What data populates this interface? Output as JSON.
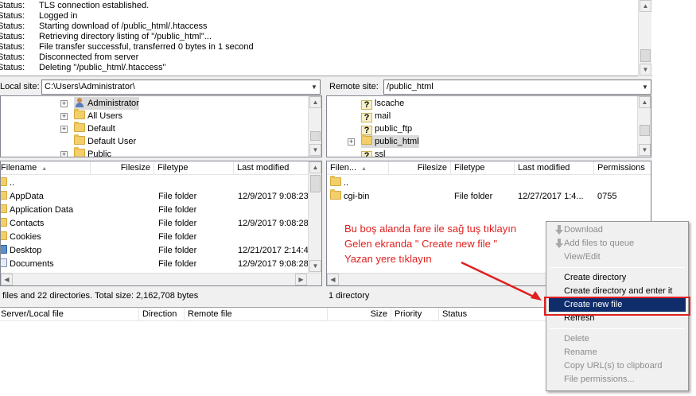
{
  "log": [
    {
      "label": "Status:",
      "text": "TLS connection established."
    },
    {
      "label": "Status:",
      "text": "Logged in"
    },
    {
      "label": "Status:",
      "text": "Starting download of /public_html/.htaccess"
    },
    {
      "label": "Status:",
      "text": "Retrieving directory listing of \"/public_html\"..."
    },
    {
      "label": "Status:",
      "text": "File transfer successful, transferred 0 bytes in 1 second"
    },
    {
      "label": "Status:",
      "text": "Disconnected from server"
    },
    {
      "label": "Status:",
      "text": "Deleting \"/public_html/.htaccess\""
    }
  ],
  "local_site": {
    "label": "Local site:",
    "path": "C:\\Users\\Administrator\\"
  },
  "remote_site": {
    "label": "Remote site:",
    "path": "/public_html"
  },
  "local_tree": [
    "Administrator",
    "All Users",
    "Default",
    "Default User",
    "Public"
  ],
  "remote_tree": [
    "lscache",
    "mail",
    "public_ftp",
    "public_html",
    "ssl"
  ],
  "local_columns": [
    "Filename",
    "Filesize",
    "Filetype",
    "Last modified"
  ],
  "local_files": [
    {
      "name": "..",
      "type": "",
      "modified": ""
    },
    {
      "name": "AppData",
      "type": "File folder",
      "modified": "12/9/2017 9:08:23"
    },
    {
      "name": "Application Data",
      "type": "File folder",
      "modified": ""
    },
    {
      "name": "Contacts",
      "type": "File folder",
      "modified": "12/9/2017 9:08:28"
    },
    {
      "name": "Cookies",
      "type": "File folder",
      "modified": ""
    },
    {
      "name": "Desktop",
      "type": "File folder",
      "modified": "12/21/2017 2:14:4"
    },
    {
      "name": "Documents",
      "type": "File folder",
      "modified": "12/9/2017 9:08:28"
    }
  ],
  "local_status": "files and 22 directories. Total size: 2,162,708 bytes",
  "remote_columns": [
    "Filen...",
    "Filesize",
    "Filetype",
    "Last modified",
    "Permissions"
  ],
  "remote_files": [
    {
      "name": "..",
      "type": "",
      "modified": "",
      "perms": ""
    },
    {
      "name": "cgi-bin",
      "type": "File folder",
      "modified": "12/27/2017 1:4...",
      "perms": "0755"
    }
  ],
  "remote_status": "1 directory",
  "queue_columns": [
    "Server/Local file",
    "Direction",
    "Remote file",
    "Size",
    "Priority",
    "Status"
  ],
  "context_menu": {
    "items": [
      {
        "label": "Download",
        "enabled": false
      },
      {
        "label": "Add files to queue",
        "enabled": false
      },
      {
        "label": "View/Edit",
        "enabled": false
      },
      {
        "label": "Create directory",
        "enabled": true
      },
      {
        "label": "Create directory and enter it",
        "enabled": true
      },
      {
        "label": "Create new file",
        "enabled": true,
        "highlighted": true
      },
      {
        "label": "Refresh",
        "enabled": true
      },
      {
        "label": "Delete",
        "enabled": false
      },
      {
        "label": "Rename",
        "enabled": false
      },
      {
        "label": "Copy URL(s) to clipboard",
        "enabled": false
      },
      {
        "label": "File permissions...",
        "enabled": false
      }
    ]
  },
  "annotation": {
    "line1": "Bu boş alanda fare ile sağ tuş tıklayın",
    "line2": "Gelen ekranda \" Create new file \"",
    "line3": "Yazan yere tıklayın",
    "color": "#e02020"
  },
  "colors": {
    "menu_highlight": "#0f2d6b",
    "folder": "#f2cf6a"
  }
}
